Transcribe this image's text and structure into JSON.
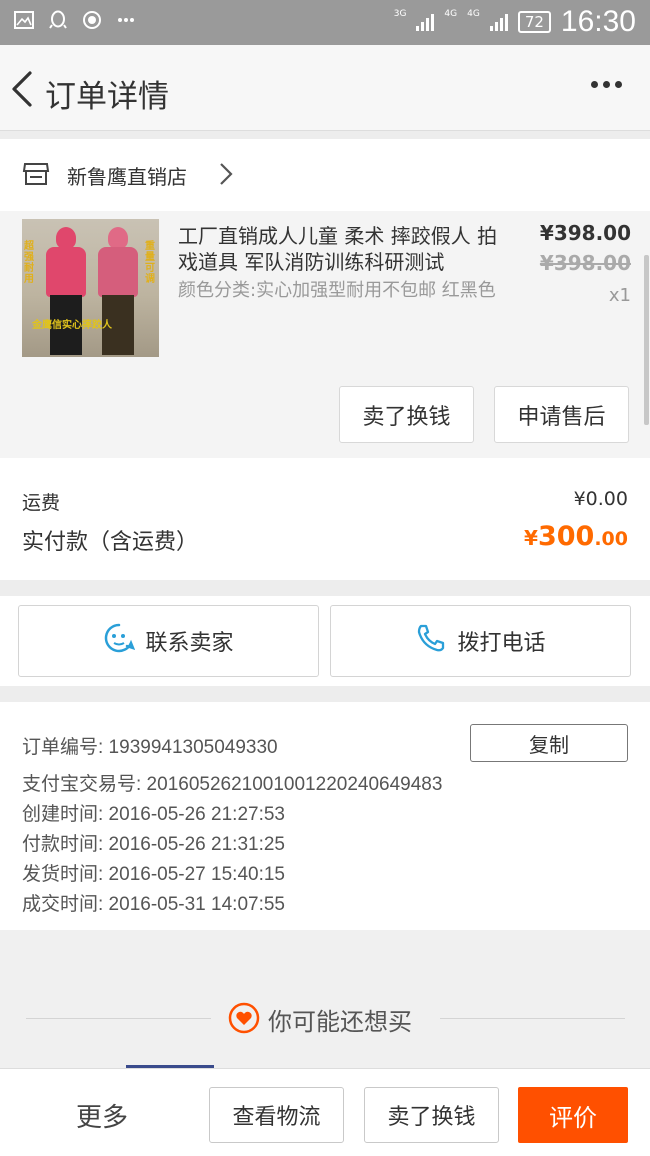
{
  "status_bar": {
    "network1": "3G",
    "network2": "4G",
    "network3": "4G",
    "sim_index": "2",
    "battery": "72",
    "time": "16:30",
    "left_icons": [
      "image-icon",
      "qq-icon",
      "record-icon",
      "more-dots"
    ]
  },
  "header": {
    "title": "订单详情"
  },
  "shop": {
    "name": "新鲁鹰直销店"
  },
  "product": {
    "title": "工厂直销成人儿童 柔术 摔跤假人 拍戏道具 军队消防训练科研测试",
    "sku": "颜色分类:实心加强型耐用不包邮 红黑色",
    "price": "¥398.00",
    "original_price": "¥398.00",
    "quantity": "x1",
    "image_text_left": "超强耐用",
    "image_text_right": "重量可调",
    "image_caption": "金鹰信实心摔跤人",
    "buttons": [
      "卖了换钱",
      "申请售后"
    ]
  },
  "totals": {
    "shipping_label": "运费",
    "shipping_value": "¥0.00",
    "paid_label": "实付款（含运费）",
    "paid_symbol": "¥",
    "paid_integer": "300",
    "paid_decimal": ".00"
  },
  "contact": {
    "seller": "联系卖家",
    "phone": "拨打电话"
  },
  "order_info": {
    "order_no": "订单编号: 1939941305049330",
    "copy": "复制",
    "alipay_no": "支付宝交易号: 2016052621001001220240649483",
    "created": "创建时间: 2016-05-26 21:27:53",
    "paid": "付款时间: 2016-05-26 21:31:25",
    "shipped": "发货时间: 2016-05-27 15:40:15",
    "completed": "成交时间: 2016-05-31 14:07:55"
  },
  "recommend": {
    "title": "你可能还想买"
  },
  "bottom_bar": {
    "more": "更多",
    "logistics": "查看物流",
    "resell": "卖了换钱",
    "review": "评价"
  },
  "colors": {
    "accent_orange": "#ff5000",
    "price_orange": "#ff6a00",
    "icon_blue": "#2a9fd8"
  }
}
